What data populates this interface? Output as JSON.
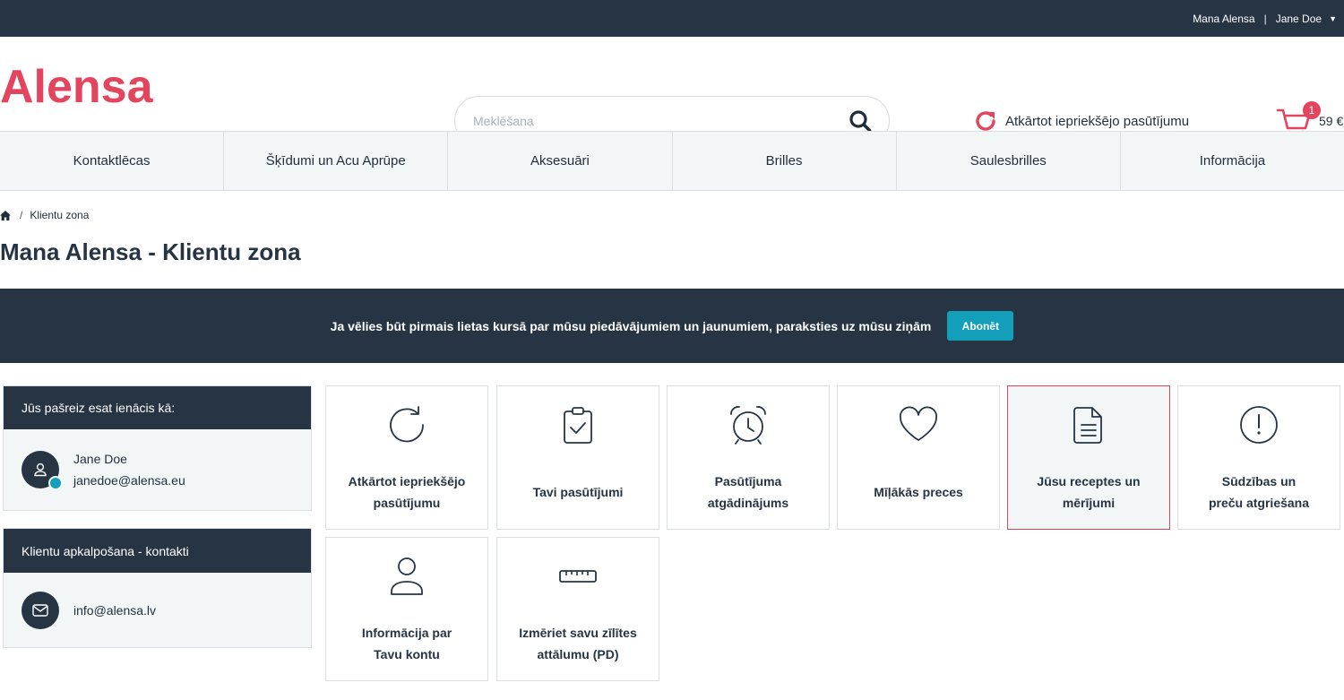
{
  "topbar": {
    "account_link": "Mana Alensa",
    "separator": "|",
    "user_name": "Jane Doe"
  },
  "brand": {
    "logo_text": "Alensa",
    "color": "#e2455d"
  },
  "search": {
    "placeholder": "Meklēšana"
  },
  "header": {
    "reorder_label": "Atkārtot iepriekšējo pasūtījumu"
  },
  "cart": {
    "count": "1",
    "total": "59 €"
  },
  "nav": {
    "items": [
      "Kontaktlēcas",
      "Šķīdumi un Acu Aprūpe",
      "Aksesuāri",
      "Brilles",
      "Saulesbrilles",
      "Informācija"
    ]
  },
  "breadcrumb": {
    "separator": "/",
    "current": "Klientu zona"
  },
  "page": {
    "title": "Mana Alensa - Klientu zona"
  },
  "newsletter": {
    "text": "Ja vēlies būt pirmais lietas kursā par mūsu piedāvājumiem un jaunumiem, paraksties uz mūsu ziņām",
    "button": "Abonēt"
  },
  "logged_in": {
    "heading": "Jūs pašreiz esat ienācis kā:",
    "name": "Jane Doe",
    "email": "janedoe@alensa.eu"
  },
  "support": {
    "heading": "Klientu apkalpošana - kontakti",
    "email": "info@alensa.lv"
  },
  "tiles": [
    {
      "line1": "Atkārtot iepriekšējo",
      "line2": "pasūtījumu",
      "icon": "refresh-icon"
    },
    {
      "line1": "Tavi pasūtījumi",
      "line2": "",
      "icon": "clipboard-check-icon"
    },
    {
      "line1": "Pasūtījuma",
      "line2": "atgādinājums",
      "icon": "alarm-clock-icon"
    },
    {
      "line1": "Mīļākās preces",
      "line2": "",
      "icon": "heart-icon"
    },
    {
      "line1": "Jūsu receptes un",
      "line2": "mērījumi",
      "icon": "document-icon"
    },
    {
      "line1": "Sūdzības un",
      "line2": "preču atgriešana",
      "icon": "alert-circle-icon"
    },
    {
      "line1": "Informācija par",
      "line2": "Tavu kontu",
      "icon": "user-icon"
    },
    {
      "line1": "Izmēriet savu zīlītes",
      "line2": "attālumu (PD)",
      "icon": "ruler-icon"
    }
  ],
  "colors": {
    "dark": "#263444",
    "accent": "#e2455d",
    "teal": "#139eb9",
    "panel_bg": "#f2f6f6"
  }
}
